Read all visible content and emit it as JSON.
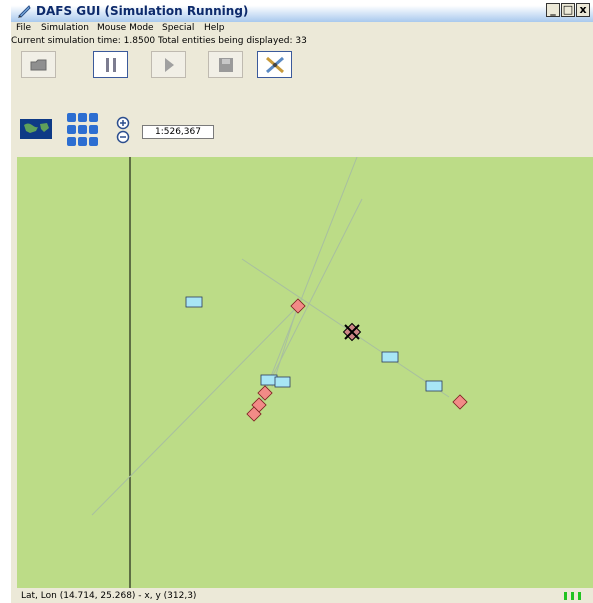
{
  "window": {
    "title": "DAFS GUI  (Simulation Running)"
  },
  "titlebar_buttons": [
    "_",
    "□",
    "x"
  ],
  "menu": [
    "File",
    "Simulation",
    "Mouse Mode",
    "Special",
    "Help"
  ],
  "status": {
    "text": "Current simulation time: 1.8500  Total entities being displayed: 33"
  },
  "toolbar": {
    "buttons": [
      {
        "name": "open-icon",
        "active": false
      },
      {
        "name": "pause-icon",
        "active": true
      },
      {
        "name": "play-icon",
        "active": false
      },
      {
        "name": "save-icon",
        "active": false
      },
      {
        "name": "tools-icon",
        "active": true
      }
    ]
  },
  "toolbar2": {
    "icons": [
      "world-map-icon",
      "entity-grid-icon",
      "zoom-in-icon",
      "zoom-out-icon"
    ],
    "scale": "1:526,367"
  },
  "map": {
    "background": "#bcdc87",
    "divider_color": "#000000",
    "friendly_color": "#a8e6f5",
    "hostile_color": "#f28b87"
  },
  "footer": {
    "coords": "Lat, Lon (14.714, 25.268) - x, y (312,3)"
  }
}
